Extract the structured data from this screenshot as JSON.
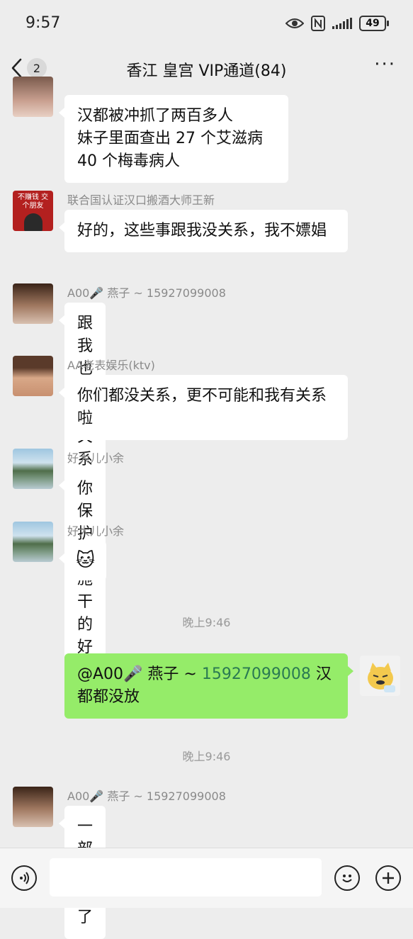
{
  "status": {
    "time": "9:57",
    "battery": "49"
  },
  "header": {
    "back_count": "2",
    "title": "香江 皇宫 VIP通道(84)",
    "more": "···"
  },
  "messages": {
    "m1": {
      "lines": [
        "汉都被冲抓了两百多人",
        "妹子里面查出 27 个艾滋病",
        "40 个梅毒病人"
      ]
    },
    "m2": {
      "nick": "联合国认证汉口搬酒大师王新",
      "text": "好的，这些事跟我没关系，我不嫖娼",
      "avatar_text": "不赚钱 交个朋友"
    },
    "m3": {
      "nick": "A00🎤 燕子 ~ 15927099008",
      "text": "跟我也没有关系"
    },
    "m4": {
      "nick": "AA老表娱乐(ktv)",
      "text": "你们都没关系，更不可能和我有关系啦"
    },
    "m5": {
      "nick": "好大儿小余",
      "text": "你保护措施干的好"
    },
    "m6": {
      "nick": "好大儿小余",
      "emoji": "🐱"
    },
    "ts1": "晚上9:46",
    "m7": {
      "mention_prefix": "@A00🎤 燕子 ~ ",
      "mention_num": "15927099008",
      "rest1": " 汉",
      "rest2": "都都没放"
    },
    "ts2": "晚上9:46",
    "m8": {
      "nick": "A00🎤 燕子 ~ 15927099008",
      "text": "一部分放了"
    }
  },
  "inputbar": {
    "voice_icon": "voice-icon",
    "emoji_icon": "emoji-icon",
    "plus_icon": "plus-icon"
  },
  "colors": {
    "background": "#ededed",
    "my_bubble": "#95ec69",
    "other_bubble": "#ffffff"
  }
}
